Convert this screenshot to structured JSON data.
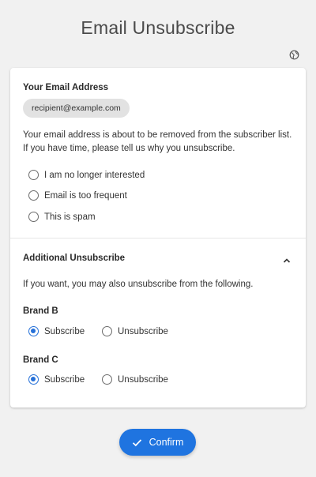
{
  "page": {
    "title": "Email Unsubscribe"
  },
  "email_section": {
    "heading": "Your Email Address",
    "email": "recipient@example.com",
    "line1": "Your email address is about to be removed from the subscriber list.",
    "line2": "If you have time, please tell us why you unsubscribe."
  },
  "reasons": [
    {
      "label": "I am no longer interested",
      "checked": false
    },
    {
      "label": "Email is too frequent",
      "checked": false
    },
    {
      "label": "This is spam",
      "checked": false
    }
  ],
  "additional": {
    "heading": "Additional Unsubscribe",
    "expanded": true,
    "description": "If you want, you may also unsubscribe from the following.",
    "brands": [
      {
        "name": "Brand B",
        "options": [
          "Subscribe",
          "Unsubscribe"
        ],
        "selected": "Subscribe"
      },
      {
        "name": "Brand C",
        "options": [
          "Subscribe",
          "Unsubscribe"
        ],
        "selected": "Subscribe"
      }
    ]
  },
  "confirm_button": {
    "label": "Confirm"
  },
  "icons": {
    "language": "globe-icon",
    "collapse": "chevron-up-icon",
    "confirm": "check-icon"
  },
  "colors": {
    "accent": "#1f74e0",
    "background": "#f1f1f1",
    "card": "#ffffff"
  }
}
